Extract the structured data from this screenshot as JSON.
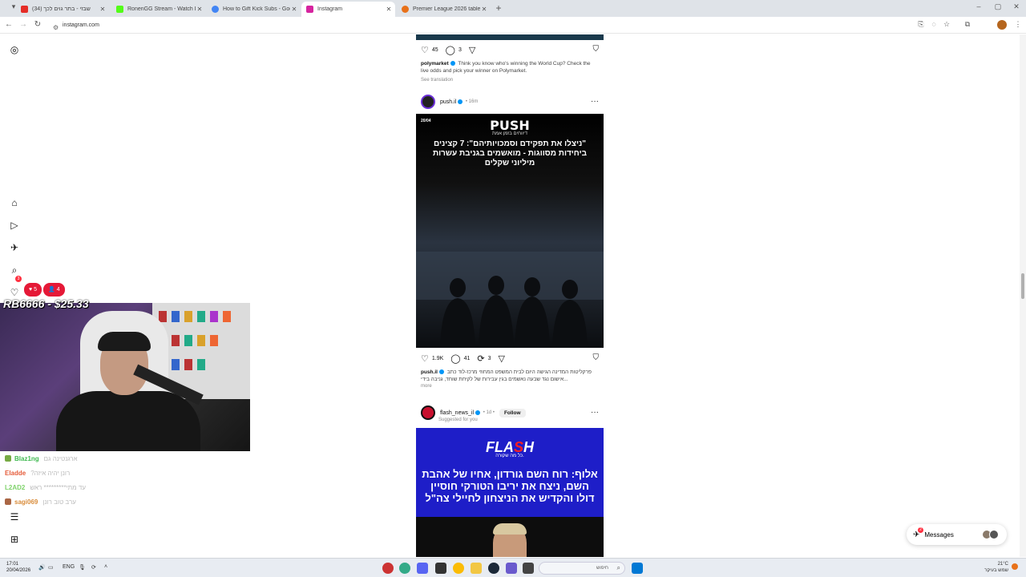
{
  "browser": {
    "tabs": [
      {
        "title": "שבזי - בתר גוים לכך (34)",
        "active": false,
        "color": "#e52d27"
      },
      {
        "title": "RonenGG Stream - Watch Live",
        "active": false,
        "color": "#53fc18"
      },
      {
        "title": "How to Gift Kick Subs - Google",
        "active": false,
        "color": "#4285f4"
      },
      {
        "title": "Instagram",
        "active": true,
        "color": "#d6249f"
      },
      {
        "title": "Premier League 2026 table, fix",
        "active": false,
        "color": "#e8711a"
      }
    ],
    "url": "instagram.com"
  },
  "feed": {
    "post1": {
      "likes": "45",
      "comments": "3",
      "username": "polymarket",
      "caption": "Think you know who's winning the World Cup? Check the live odds and pick your winner on Polymarket.",
      "see_translation": "See translation"
    },
    "post2": {
      "username": "push.il",
      "time": "16m",
      "image": {
        "date": "20/04",
        "logo": "PUSH",
        "subtitle": "דיווחים בזמן אמת",
        "headline": "\"ניצלו את תפקידם וסמכויותיהם\": 7 קצינים ביחידות מסווגות - מואשמים בגניבת עשרות מיליוני שקלים"
      },
      "likes": "1.9K",
      "comments": "41",
      "reposts": "3",
      "caption": "פרקליטות המדינה הגישה היום לבית המשפט המחוזי מרכז-לוד כתב אישום נגד שבעה נאשמים בגין עבירות של לקיחת שוחד, גניבה בידי...",
      "more": "more"
    },
    "post3": {
      "username": "flash_news_il",
      "time": "1d",
      "follow": "Follow",
      "suggested": "Suggested for you",
      "image": {
        "logo_a": "FLA",
        "logo_b": "S",
        "logo_c": "H",
        "tagline": "כל מה שקורה.",
        "headline": "אלוף: רוח השם גורדון, אחיו של אהבת השם, ניצח את יריבו הטורקי חוסיין דולו והקדיש את הניצחון לחיילי צה\"ל"
      }
    }
  },
  "overlay": {
    "donation": "RB6666 - $25.33",
    "likes": "5",
    "viewers": "4",
    "chat": [
      {
        "name": "Blaz1ng",
        "text": "ארגנטינה גם",
        "color": "#3fb950"
      },
      {
        "name": "Eladde",
        "text": "רונן יהיה איזה?",
        "color": "#e55d3b"
      },
      {
        "name": "L2AD2",
        "text": "עד מתי********* ראש",
        "color": "#7fd36b"
      },
      {
        "name": "sagi069",
        "text": "ערב טוב רונן",
        "color": "#d98c3a"
      }
    ]
  },
  "messages": {
    "label": "Messages",
    "badge": "2"
  },
  "sidebar": {
    "notif_badge": "3"
  },
  "taskbar": {
    "time": "17:01",
    "date": "20/04/2026",
    "lang": "ENG",
    "search": "חיפוש",
    "weather_temp": "21°C",
    "weather_desc": "שמש בעיקר"
  }
}
